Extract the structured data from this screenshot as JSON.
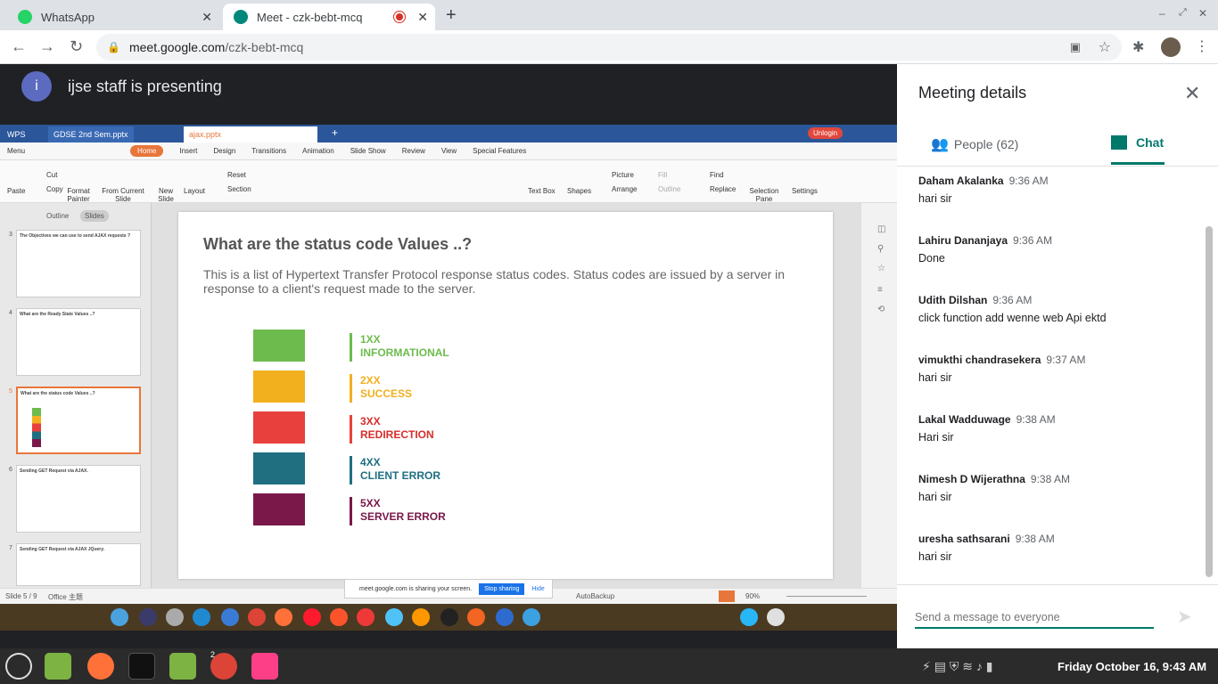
{
  "browser": {
    "tabs": [
      {
        "title": "WhatsApp",
        "icon": "whatsapp-icon"
      },
      {
        "title": "Meet - czk-bebt-mcq",
        "icon": "meet-icon"
      }
    ],
    "url": "meet.google.com/czk-bebt-mcq",
    "url_host": "meet.google.com",
    "url_path": "/czk-bebt-mcq"
  },
  "meet": {
    "presenter_initial": "i",
    "presenter_text": "ijse staff is presenting"
  },
  "wps": {
    "tabs": [
      "WPS",
      "GDSE 2nd Sem.pptx",
      "ajax.pptx"
    ],
    "unlogin": "Unlogin",
    "menu": [
      "Menu",
      "Home",
      "Insert",
      "Design",
      "Transitions",
      "Animation",
      "Slide Show",
      "Review",
      "View",
      "Special Features"
    ],
    "ribbon": [
      "Paste",
      "Cut",
      "Copy",
      "Format Painter",
      "From Current Slide",
      "New Slide",
      "Layout",
      "Reset",
      "Section",
      "Text Box",
      "Shapes",
      "Picture",
      "Arrange",
      "Fill",
      "Outline",
      "Find",
      "Replace",
      "Selection Pane",
      "Settings"
    ],
    "outline_tabs": [
      "Outline",
      "Slides"
    ],
    "thumb_numbers": [
      "3",
      "4",
      "5",
      "6",
      "7"
    ],
    "thumb_titles": [
      "The Objectives we can use to send AJAX requests ?",
      "What are the Ready State Values ..?",
      "What are the status code Values ..?",
      "Sending GET Request via AJAX.",
      "Sending GET Request via AJAX JQuery."
    ],
    "slide_title": "What are the status code Values ..?",
    "slide_body": "This is a list of Hypertext Transfer Protocol response status codes. Status codes are issued by a server in response to a client's request made to the server.",
    "codes": [
      {
        "code": "1XX",
        "name": "INFORMATIONAL",
        "color": "#6dbb4d"
      },
      {
        "code": "2XX",
        "name": "SUCCESS",
        "color": "#f2b01e"
      },
      {
        "code": "3XX",
        "name": "REDIRECTION",
        "color": "#e8413d"
      },
      {
        "code": "4XX",
        "name": "CLIENT ERROR",
        "color": "#1f6f80"
      },
      {
        "code": "5XX",
        "name": "SERVER ERROR",
        "color": "#7a1849"
      }
    ],
    "status_left": "Slide 5 / 9",
    "status_theme": "Office 主题",
    "autobackup": "AutoBackup",
    "zoom": "90%",
    "sharing_text": "meet.google.com is sharing your screen.",
    "stop_sharing": "Stop sharing",
    "hide": "Hide"
  },
  "panel": {
    "title": "Meeting details",
    "people_label": "People (62)",
    "chat_label": "Chat",
    "messages": [
      {
        "name": "Daham Akalanka",
        "time": "9:36 AM",
        "text": "hari sir"
      },
      {
        "name": "Lahiru Dananjaya",
        "time": "9:36 AM",
        "text": "Done"
      },
      {
        "name": "Udith Dilshan",
        "time": "9:36 AM",
        "text": "click function add wenne web Api ektd"
      },
      {
        "name": "vimukthi chandrasekera",
        "time": "9:37 AM",
        "text": "hari sir"
      },
      {
        "name": "Lakal Wadduwage",
        "time": "9:38 AM",
        "text": "Hari sir"
      },
      {
        "name": "Nimesh D Wijerathna",
        "time": "9:38 AM",
        "text": "hari sir"
      },
      {
        "name": "uresha sathsarani",
        "time": "9:38 AM",
        "text": "hari sir"
      }
    ],
    "input_placeholder": "Send a message to everyone"
  },
  "taskbar": {
    "clock": "Friday October 16, 9:43 AM",
    "chrome_badge": "2"
  }
}
